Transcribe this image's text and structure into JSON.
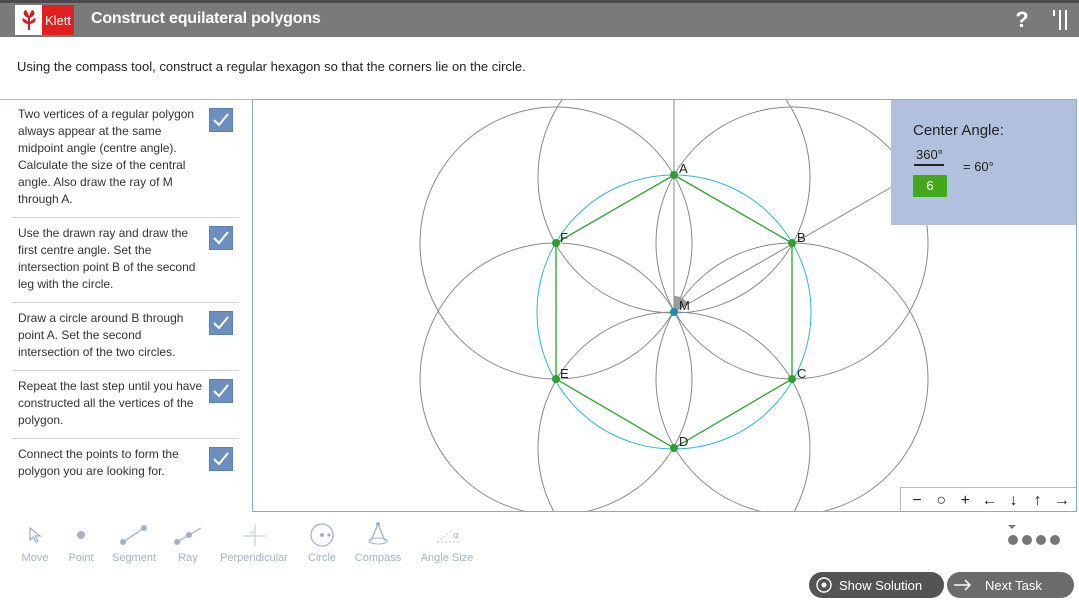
{
  "header": {
    "logo_text": "Klett",
    "title": "Construct equilateral polygons",
    "help_label": "?"
  },
  "instruction": "Using the compass tool, construct a regular hexagon so that the corners lie on the circle.",
  "tasks": [
    {
      "text": "Two vertices of a regular polygon always appear at the same midpoint angle (centre angle). Calculate the size of the central angle. Also draw the ray of M through A.",
      "done": true
    },
    {
      "text": "Use the drawn ray and draw the first centre angle. Set the intersection point B of the second leg with the circle.",
      "done": true
    },
    {
      "text": "Draw a circle around B through point A. Set the second intersection of the two circles.",
      "done": true
    },
    {
      "text": "Repeat the last step until you have constructed all the vertices of the polygon.",
      "done": true
    },
    {
      "text": "Connect the points to form the polygon you are looking for.",
      "done": true
    }
  ],
  "angle_panel": {
    "title": "Center Angle:",
    "numerator": "360°",
    "result": "=  60°",
    "input_value": "6"
  },
  "points": [
    {
      "label": "A"
    },
    {
      "label": "B"
    },
    {
      "label": "C"
    },
    {
      "label": "D"
    },
    {
      "label": "E"
    },
    {
      "label": "F"
    },
    {
      "label": "M"
    }
  ],
  "zoom_controls": [
    "−",
    "○",
    "+",
    "←",
    "↓",
    "↑",
    "→"
  ],
  "tools": [
    {
      "label": "Move",
      "icon": "cursor-arrow-icon"
    },
    {
      "label": "Point",
      "icon": "point-icon"
    },
    {
      "label": "Segment",
      "icon": "segment-icon"
    },
    {
      "label": "Ray",
      "icon": "ray-icon"
    },
    {
      "label": "Perpendicular",
      "icon": "perpendicular-icon"
    },
    {
      "label": "Circle",
      "icon": "circle-icon"
    },
    {
      "label": "Compass",
      "icon": "compass-icon"
    },
    {
      "label": "Angle Size",
      "icon": "angle-size-icon"
    }
  ],
  "buttons": {
    "show_solution": "Show Solution",
    "next_task": "Next Task"
  },
  "colors": {
    "header": "#7a7a7a",
    "brand_red": "#e02020",
    "check_blue": "#6d8fc0",
    "hexagon_green": "#2da02d",
    "circle_cyan": "#33b5d8",
    "panel_blue": "#b1c1dd"
  }
}
